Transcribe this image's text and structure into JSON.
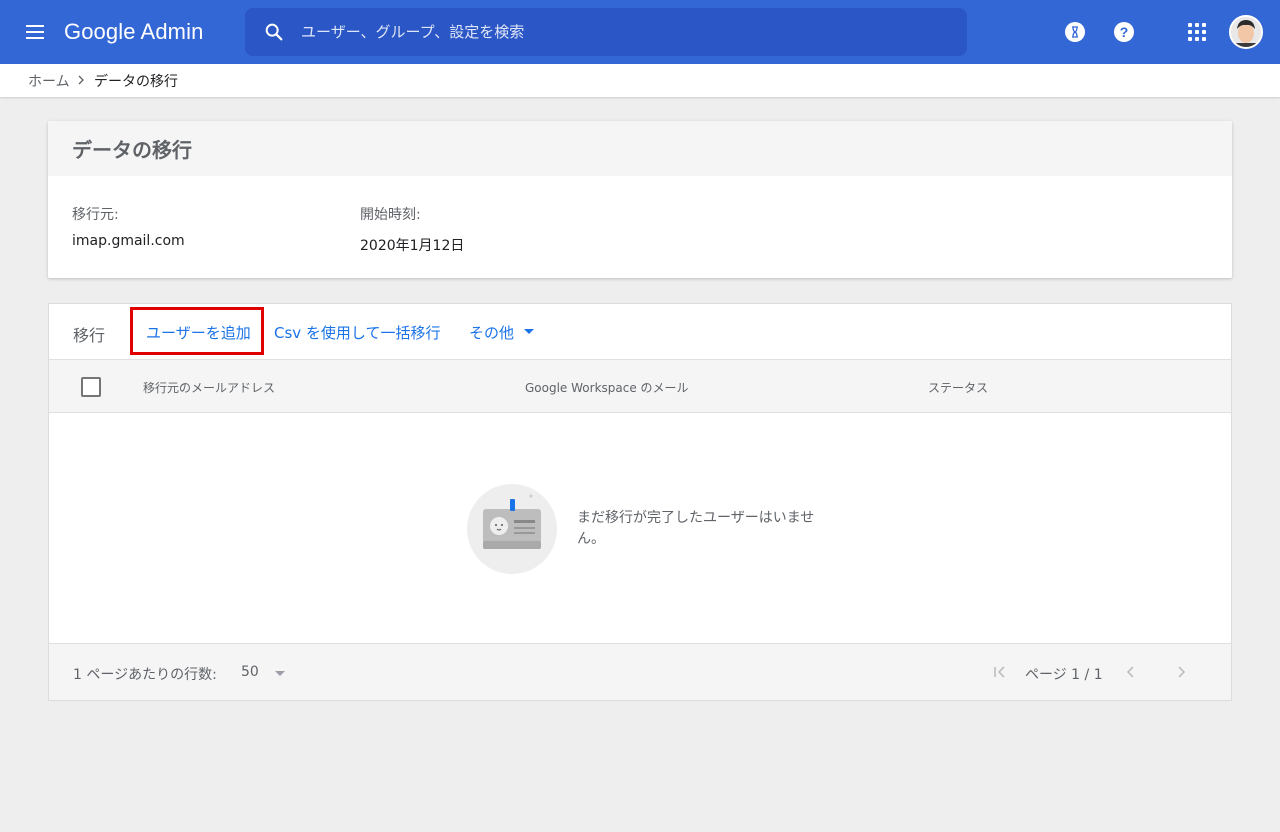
{
  "app": {
    "logo_text": "Google Admin"
  },
  "search": {
    "placeholder": "ユーザー、グループ、設定を検索"
  },
  "topbar": {
    "help_label": "?"
  },
  "breadcrumb": {
    "home": "ホーム",
    "current": "データの移行"
  },
  "info_card": {
    "title": "データの移行",
    "source_label": "移行元:",
    "source_value": "imap.gmail.com",
    "start_label": "開始時刻:",
    "start_value": "2020年1月12日"
  },
  "migration": {
    "toolbar_label": "移行",
    "add_user": "ユーザーを追加",
    "bulk_csv": "Csv を使用して一括移行",
    "more": "その他",
    "columns": [
      "移行元のメールアドレス",
      "Google Workspace のメール",
      "ステータス"
    ],
    "empty_message": "まだ移行が完了したユーザーはいません。",
    "rows_per_page_label": "1 ページあたりの行数:",
    "rows_per_page_value": "50",
    "page_info": "ページ 1 / 1"
  },
  "colors": {
    "topbar": "#3367d6",
    "link": "#1a73e8",
    "highlight": "#e00000"
  }
}
